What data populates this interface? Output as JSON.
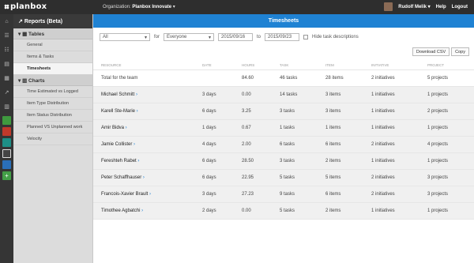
{
  "topbar": {
    "logo": "planbox",
    "org_label": "Organization:",
    "org_name": "Planbox Innovate",
    "org_caret": "▾",
    "user": "Rudolf Melik",
    "user_caret": "▾",
    "help": "Help",
    "logout": "Logout"
  },
  "iconbar": {
    "items": [
      {
        "icon": "home-icon",
        "glyph": "⌂"
      },
      {
        "icon": "list-icon",
        "glyph": "☰"
      },
      {
        "icon": "list-alt-icon",
        "glyph": "☷"
      },
      {
        "icon": "layers-icon",
        "glyph": "▤"
      },
      {
        "icon": "calendar-icon",
        "glyph": "▦"
      },
      {
        "icon": "trend-icon",
        "glyph": "↗"
      },
      {
        "icon": "chart-icon",
        "glyph": "▥"
      }
    ],
    "squares": [
      {
        "icon": "app-green-icon",
        "color": "#3f9a3f"
      },
      {
        "icon": "app-red-icon",
        "color": "#c0392b"
      },
      {
        "icon": "app-teal-icon",
        "color": "#1d8f86"
      },
      {
        "icon": "app-bracket-icon",
        "color": "#444444"
      },
      {
        "icon": "app-blue-icon",
        "color": "#2a6fb8"
      },
      {
        "icon": "add-icon",
        "color": "#43a047"
      }
    ]
  },
  "sidebar": {
    "title": "Reports (Beta)",
    "sections": [
      {
        "label": "Tables",
        "items": [
          {
            "label": "General",
            "active": false
          },
          {
            "label": "Items & Tasks",
            "active": false
          },
          {
            "label": "Timesheets",
            "active": true
          }
        ]
      },
      {
        "label": "Charts",
        "items": [
          {
            "label": "Time Estimated vs Logged",
            "active": false
          },
          {
            "label": "Item Type Distribution",
            "active": false
          },
          {
            "label": "Item Status Distribution",
            "active": false
          },
          {
            "label": "Planned VS Unplanned work",
            "active": false
          },
          {
            "label": "Velocity",
            "active": false
          }
        ]
      }
    ]
  },
  "main": {
    "title": "Timesheets",
    "filters": {
      "scope": "All",
      "for_label": "for",
      "who": "Everyone",
      "from_date": "2015/09/16",
      "to_label": "to",
      "to_date": "2015/09/23",
      "hide_label": "Hide task descriptions"
    },
    "buttons": {
      "download": "Download CSV",
      "copy": "Copy"
    },
    "table": {
      "headers": [
        "Resource",
        "Date",
        "Hours",
        "Task",
        "Item",
        "Initiative",
        "Project"
      ],
      "total": [
        "Total for the team",
        "",
        "84.60",
        "46 tasks",
        "28 items",
        "2 initiatives",
        "5 projects"
      ],
      "rows": [
        [
          "Michael Schmitt",
          "3 days",
          "0.00",
          "14 tasks",
          "3 items",
          "1 initiatives",
          "1 projects"
        ],
        [
          "Karell Ste-Marie",
          "6 days",
          "3.25",
          "3 tasks",
          "3 items",
          "1 initiatives",
          "2 projects"
        ],
        [
          "Amir Bidva",
          "1 days",
          "0.67",
          "1 tasks",
          "1 items",
          "1 initiatives",
          "1 projects"
        ],
        [
          "Jamie Collister",
          "4 days",
          "2.00",
          "6 tasks",
          "6 items",
          "2 initiatives",
          "4 projects"
        ],
        [
          "Fereshteh Rabet",
          "6 days",
          "28.50",
          "3 tasks",
          "2 items",
          "1 initiatives",
          "1 projects"
        ],
        [
          "Peter Schaffhauser",
          "6 days",
          "22.95",
          "5 tasks",
          "5 items",
          "2 initiatives",
          "3 projects"
        ],
        [
          "Francois-Xavier Brault",
          "3 days",
          "27.23",
          "9 tasks",
          "6 items",
          "2 initiatives",
          "3 projects"
        ],
        [
          "Timothee Agbatchi",
          "2 days",
          "0.00",
          "5 tasks",
          "2 items",
          "1 initiatives",
          "1 projects"
        ]
      ]
    }
  },
  "colors": {
    "accent": "#1f82d3",
    "topbar": "#2e2e2e",
    "sidebar": "#dcdcdc"
  }
}
